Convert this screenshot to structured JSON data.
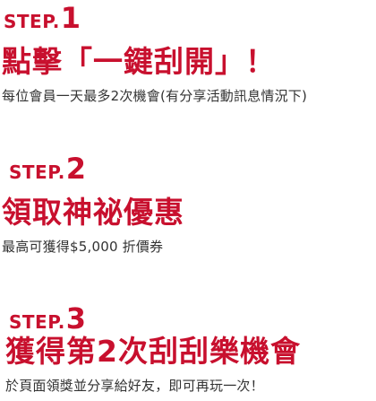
{
  "steps": [
    {
      "step_word": "STEP.",
      "step_number": "1",
      "title": "點擊「一鍵刮開」！",
      "description": "每位會員一天最多2次機會(有分享活動訊息情況下)"
    },
    {
      "step_word": "STEP.",
      "step_number": "2",
      "title": "領取神祕優惠",
      "description": "最高可獲得$5,000 折價券"
    },
    {
      "step_word": "STEP.",
      "step_number": "3",
      "title": "獲得第2次刮刮樂機會",
      "description": "於頁面領獎並分享給好友，即可再玩一次！"
    }
  ]
}
